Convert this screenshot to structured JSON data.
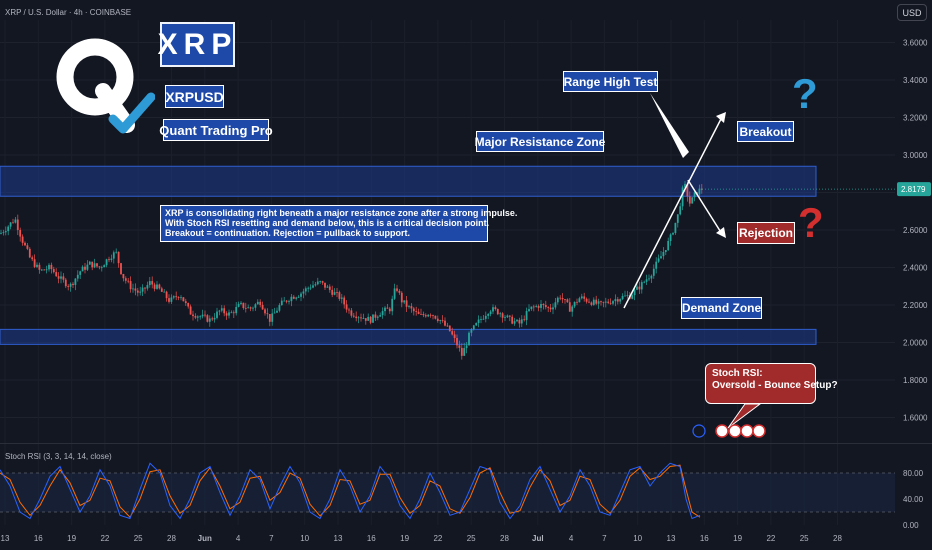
{
  "header": {
    "symbol": "XRP / U.S. Dollar · 4h · COINBASE",
    "currency": "USD"
  },
  "branding": {
    "logo_icon": "quant-q-logo-with-checkmark",
    "title": "XRP",
    "ticker": "XRPUSD",
    "publisher": "Quant Trading Pro"
  },
  "annotations": {
    "range_high": "Range High Test",
    "resistance": "Major Resistance Zone",
    "breakout": "Breakout",
    "rejection": "Rejection",
    "demand": "Demand Zone",
    "note_lines": [
      "XRP is consolidating right beneath a major resistance zone after a strong impulse.",
      "With Stoch RSI resetting and demand below, this is a critical decision point.",
      "Breakout = continuation. Rejection = pullback to support."
    ],
    "stoch_callout": [
      "Stoch RSI:",
      "Oversold - Bounce Setup?"
    ],
    "question_mark": "?"
  },
  "colors": {
    "background": "#131722",
    "candle_up": "#26a69a",
    "candle_down": "#ef5350",
    "zone_fill": "#1e3a8a",
    "label_blue": "#1e49a8",
    "label_red": "#a12b2b",
    "qmark_blue": "#2e9bd6",
    "qmark_red": "#d32f2f",
    "stoch_k": "#2962ff",
    "stoch_d": "#ff6d00",
    "price_tag": "#26a69a"
  },
  "chart_data": {
    "type": "candlestick",
    "price_axis": {
      "ticks": [
        "3.6000",
        "3.4000",
        "3.2000",
        "3.0000",
        "2.8000",
        "2.6000",
        "2.4000",
        "2.2000",
        "2.0000",
        "1.8000",
        "1.6000"
      ],
      "ylim": [
        1.48,
        3.72
      ],
      "last_price": "2.8179"
    },
    "time_axis": {
      "ticks": [
        "13",
        "16",
        "19",
        "22",
        "25",
        "28",
        "Jun",
        "4",
        "7",
        "10",
        "13",
        "16",
        "19",
        "22",
        "25",
        "28",
        "Jul",
        "4",
        "7",
        "10",
        "13",
        "16",
        "19",
        "22",
        "25",
        "28"
      ]
    },
    "zones": [
      {
        "name": "Major Resistance Zone",
        "low": 2.78,
        "high": 2.94
      },
      {
        "name": "Demand Zone",
        "low": 1.99,
        "high": 2.07
      }
    ],
    "price_path": [
      [
        0,
        2.58
      ],
      [
        8,
        2.62
      ],
      [
        15,
        2.66
      ],
      [
        22,
        2.55
      ],
      [
        30,
        2.45
      ],
      [
        40,
        2.38
      ],
      [
        50,
        2.4
      ],
      [
        60,
        2.34
      ],
      [
        70,
        2.3
      ],
      [
        80,
        2.38
      ],
      [
        90,
        2.42
      ],
      [
        100,
        2.4
      ],
      [
        110,
        2.46
      ],
      [
        116,
        2.48
      ],
      [
        122,
        2.36
      ],
      [
        130,
        2.3
      ],
      [
        140,
        2.26
      ],
      [
        150,
        2.32
      ],
      [
        160,
        2.28
      ],
      [
        170,
        2.22
      ],
      [
        180,
        2.26
      ],
      [
        190,
        2.16
      ],
      [
        200,
        2.14
      ],
      [
        210,
        2.12
      ],
      [
        220,
        2.17
      ],
      [
        230,
        2.15
      ],
      [
        240,
        2.2
      ],
      [
        250,
        2.18
      ],
      [
        260,
        2.22
      ],
      [
        270,
        2.12
      ],
      [
        280,
        2.2
      ],
      [
        290,
        2.24
      ],
      [
        300,
        2.26
      ],
      [
        310,
        2.3
      ],
      [
        320,
        2.32
      ],
      [
        330,
        2.28
      ],
      [
        340,
        2.24
      ],
      [
        350,
        2.16
      ],
      [
        360,
        2.14
      ],
      [
        370,
        2.12
      ],
      [
        380,
        2.16
      ],
      [
        390,
        2.18
      ],
      [
        396,
        2.3
      ],
      [
        402,
        2.22
      ],
      [
        410,
        2.18
      ],
      [
        420,
        2.14
      ],
      [
        430,
        2.16
      ],
      [
        440,
        2.12
      ],
      [
        450,
        2.06
      ],
      [
        458,
        1.98
      ],
      [
        462,
        1.93
      ],
      [
        470,
        2.05
      ],
      [
        480,
        2.12
      ],
      [
        490,
        2.18
      ],
      [
        500,
        2.16
      ],
      [
        510,
        2.12
      ],
      [
        520,
        2.1
      ],
      [
        530,
        2.18
      ],
      [
        540,
        2.2
      ],
      [
        550,
        2.18
      ],
      [
        560,
        2.25
      ],
      [
        570,
        2.18
      ],
      [
        580,
        2.24
      ],
      [
        590,
        2.22
      ],
      [
        600,
        2.2
      ],
      [
        610,
        2.22
      ],
      [
        620,
        2.24
      ],
      [
        630,
        2.25
      ],
      [
        640,
        2.3
      ],
      [
        650,
        2.36
      ],
      [
        660,
        2.45
      ],
      [
        670,
        2.55
      ],
      [
        678,
        2.68
      ],
      [
        684,
        2.85
      ],
      [
        690,
        2.74
      ],
      [
        696,
        2.8
      ],
      [
        702,
        2.82
      ]
    ],
    "oscillator": {
      "label": "Stoch RSI (3, 3, 14, 14, close)",
      "ylim": [
        0,
        100
      ],
      "ticks": [
        "80.00",
        "40.00",
        "0.00"
      ],
      "k": [
        [
          0,
          85
        ],
        [
          10,
          60
        ],
        [
          20,
          20
        ],
        [
          30,
          10
        ],
        [
          40,
          40
        ],
        [
          50,
          75
        ],
        [
          60,
          90
        ],
        [
          70,
          55
        ],
        [
          80,
          20
        ],
        [
          90,
          45
        ],
        [
          100,
          85
        ],
        [
          110,
          60
        ],
        [
          120,
          15
        ],
        [
          130,
          10
        ],
        [
          140,
          55
        ],
        [
          150,
          95
        ],
        [
          160,
          80
        ],
        [
          170,
          30
        ],
        [
          180,
          10
        ],
        [
          190,
          40
        ],
        [
          200,
          80
        ],
        [
          210,
          90
        ],
        [
          220,
          50
        ],
        [
          230,
          15
        ],
        [
          240,
          45
        ],
        [
          250,
          85
        ],
        [
          260,
          70
        ],
        [
          270,
          25
        ],
        [
          280,
          60
        ],
        [
          290,
          90
        ],
        [
          300,
          65
        ],
        [
          310,
          20
        ],
        [
          320,
          10
        ],
        [
          330,
          40
        ],
        [
          340,
          85
        ],
        [
          350,
          60
        ],
        [
          360,
          20
        ],
        [
          370,
          45
        ],
        [
          380,
          90
        ],
        [
          390,
          70
        ],
        [
          400,
          30
        ],
        [
          410,
          10
        ],
        [
          420,
          40
        ],
        [
          430,
          80
        ],
        [
          440,
          50
        ],
        [
          450,
          15
        ],
        [
          460,
          20
        ],
        [
          470,
          55
        ],
        [
          480,
          90
        ],
        [
          490,
          85
        ],
        [
          500,
          35
        ],
        [
          510,
          10
        ],
        [
          520,
          30
        ],
        [
          530,
          70
        ],
        [
          540,
          90
        ],
        [
          550,
          55
        ],
        [
          560,
          20
        ],
        [
          570,
          45
        ],
        [
          580,
          85
        ],
        [
          590,
          60
        ],
        [
          600,
          20
        ],
        [
          610,
          15
        ],
        [
          620,
          50
        ],
        [
          630,
          85
        ],
        [
          640,
          90
        ],
        [
          650,
          60
        ],
        [
          660,
          80
        ],
        [
          670,
          95
        ],
        [
          680,
          90
        ],
        [
          686,
          40
        ],
        [
          692,
          10
        ],
        [
          700,
          15
        ]
      ],
      "d": [
        [
          0,
          80
        ],
        [
          10,
          70
        ],
        [
          20,
          35
        ],
        [
          30,
          15
        ],
        [
          40,
          30
        ],
        [
          50,
          60
        ],
        [
          60,
          85
        ],
        [
          70,
          65
        ],
        [
          80,
          30
        ],
        [
          90,
          38
        ],
        [
          100,
          72
        ],
        [
          110,
          68
        ],
        [
          120,
          28
        ],
        [
          130,
          12
        ],
        [
          140,
          40
        ],
        [
          150,
          82
        ],
        [
          160,
          85
        ],
        [
          170,
          45
        ],
        [
          180,
          18
        ],
        [
          190,
          30
        ],
        [
          200,
          68
        ],
        [
          210,
          88
        ],
        [
          220,
          60
        ],
        [
          230,
          25
        ],
        [
          240,
          35
        ],
        [
          250,
          72
        ],
        [
          260,
          75
        ],
        [
          270,
          38
        ],
        [
          280,
          50
        ],
        [
          290,
          80
        ],
        [
          300,
          72
        ],
        [
          310,
          32
        ],
        [
          320,
          14
        ],
        [
          330,
          30
        ],
        [
          340,
          70
        ],
        [
          350,
          68
        ],
        [
          360,
          32
        ],
        [
          370,
          38
        ],
        [
          380,
          78
        ],
        [
          390,
          78
        ],
        [
          400,
          42
        ],
        [
          410,
          18
        ],
        [
          420,
          30
        ],
        [
          430,
          68
        ],
        [
          440,
          60
        ],
        [
          450,
          25
        ],
        [
          460,
          18
        ],
        [
          470,
          42
        ],
        [
          480,
          80
        ],
        [
          490,
          88
        ],
        [
          500,
          50
        ],
        [
          510,
          18
        ],
        [
          520,
          22
        ],
        [
          530,
          58
        ],
        [
          540,
          85
        ],
        [
          550,
          68
        ],
        [
          560,
          30
        ],
        [
          570,
          38
        ],
        [
          580,
          75
        ],
        [
          590,
          70
        ],
        [
          600,
          32
        ],
        [
          610,
          18
        ],
        [
          620,
          38
        ],
        [
          630,
          75
        ],
        [
          640,
          88
        ],
        [
          650,
          70
        ],
        [
          660,
          75
        ],
        [
          670,
          90
        ],
        [
          680,
          92
        ],
        [
          686,
          55
        ],
        [
          692,
          20
        ],
        [
          700,
          12
        ]
      ]
    }
  }
}
